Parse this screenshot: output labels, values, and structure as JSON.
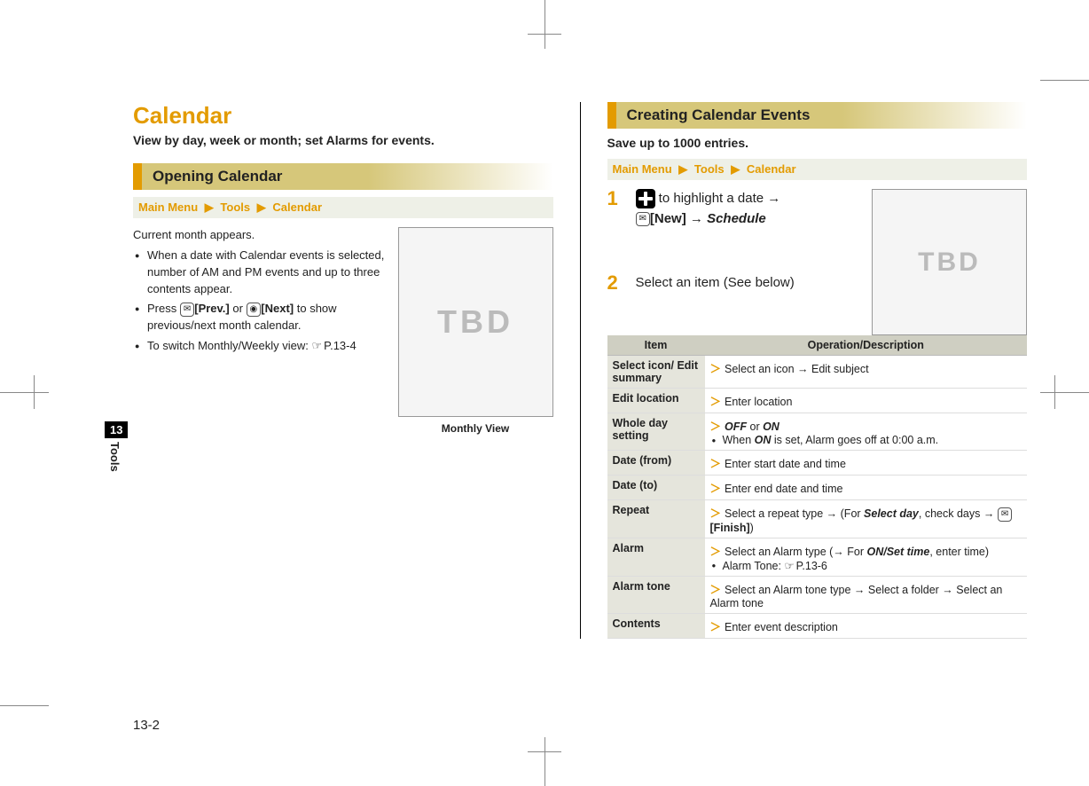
{
  "page": {
    "number": "13-2",
    "chapterNum": "13",
    "chapterLabel": "Tools"
  },
  "left": {
    "title": "Calendar",
    "subtitle": "View by day, week or month; set Alarms for events.",
    "section": "Opening Calendar",
    "breadcrumb": {
      "a": "Main Menu",
      "b": "Tools",
      "c": "Calendar"
    },
    "intro": "Current month appears.",
    "bullets": {
      "b1": "When a date with Calendar events is selected, number of AM and PM events and up to three contents appear.",
      "b2a": "Press ",
      "b2prev": "[Prev.]",
      "b2mid": " or ",
      "b2next": "[Next]",
      "b2b": " to show previous/next month calendar.",
      "b3a": "To switch Monthly/Weekly view: ",
      "b3ref": "P.13-4"
    },
    "fig": {
      "placeholder": "TBD",
      "caption": "Monthly View"
    }
  },
  "right": {
    "section": "Creating Calendar Events",
    "intro": "Save up to 1000 entries.",
    "breadcrumb": {
      "a": "Main Menu",
      "b": "Tools",
      "c": "Calendar"
    },
    "step1": {
      "num": "1",
      "t1": " to highlight a date ",
      "new": "[New]",
      "sched": "Schedule"
    },
    "step2": {
      "num": "2",
      "text": "Select an item (See below)"
    },
    "fig": {
      "placeholder": "TBD"
    },
    "table": {
      "h1": "Item",
      "h2": "Operation/Description",
      "rows": {
        "r1": {
          "item": "Select icon/\nEdit summary",
          "op": "Select an icon → Edit subject"
        },
        "r2": {
          "item": "Edit location",
          "op": "Enter location"
        },
        "r3": {
          "item": "Whole day setting",
          "op_a": "OFF",
          "op_or": " or ",
          "op_b": "ON",
          "sub": "When ",
          "sub_b": "ON",
          "sub2": " is set, Alarm goes off at 0:00 a.m."
        },
        "r4": {
          "item": "Date (from)",
          "op": "Enter start date and time"
        },
        "r5": {
          "item": "Date (to)",
          "op": "Enter end date and time"
        },
        "r6": {
          "item": "Repeat",
          "op_a": "Select a repeat type → (For ",
          "op_b": "Select day",
          "op_c": ", check days → ",
          "op_d": "[Finish]",
          "op_e": ")"
        },
        "r7": {
          "item": "Alarm",
          "op_a": "Select an Alarm type (→ For ",
          "op_b": "ON/Set time",
          "op_c": ", enter time)",
          "sub_a": "Alarm Tone: ",
          "sub_ref": "P.13-6"
        },
        "r8": {
          "item": "Alarm tone",
          "op": "Select an Alarm tone type → Select a folder → Select an Alarm tone"
        },
        "r9": {
          "item": "Contents",
          "op": "Enter event description"
        }
      }
    }
  }
}
